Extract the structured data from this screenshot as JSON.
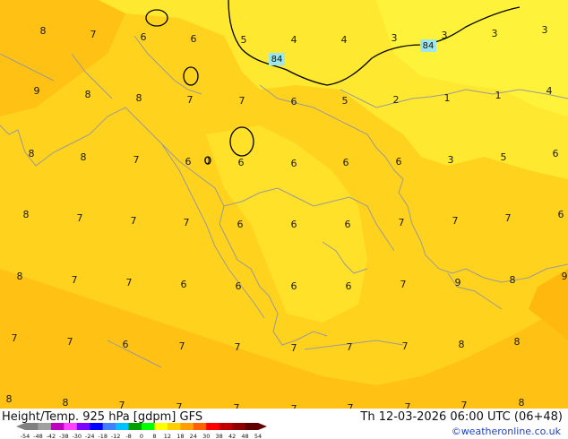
{
  "footer": {
    "title": "Height/Temp. 925 hPa [gdpm] GFS",
    "datetime": "Th 12-03-2026 06:00 UTC (06+48)",
    "credit": "©weatheronline.co.uk"
  },
  "colorbar": {
    "tick_labels": [
      "-54",
      "-48",
      "-42",
      "-38",
      "-30",
      "-24",
      "-18",
      "-12",
      "-8",
      "0",
      "8",
      "12",
      "18",
      "24",
      "30",
      "38",
      "42",
      "48",
      "54"
    ],
    "colors": [
      "#808080",
      "#a0a0a0",
      "#c000c0",
      "#ff40ff",
      "#8000ff",
      "#0000ff",
      "#4080ff",
      "#00c0ff",
      "#00a000",
      "#00ff00",
      "#ffff00",
      "#ffd000",
      "#ffa000",
      "#ff6000",
      "#ff0000",
      "#c00000",
      "#900000",
      "#600000"
    ]
  },
  "map": {
    "field_colors": {
      "dominant": "#ffd21e",
      "warm": "#ffc214",
      "cool": "#ffe830",
      "coast": "#a0a0a0",
      "contour": "#000000"
    },
    "contour_labels": [
      "84",
      "84"
    ],
    "temperature_labels": [
      "8",
      "7",
      "6",
      "6",
      "5",
      "4",
      "4",
      "3",
      "3",
      "3",
      "3",
      "9",
      "8",
      "8",
      "7",
      "7",
      "6",
      "5",
      "2",
      "1",
      "1",
      "4",
      "8",
      "8",
      "7",
      "6",
      "0",
      "6",
      "6",
      "6",
      "6",
      "3",
      "5",
      "6",
      "8",
      "7",
      "7",
      "7",
      "6",
      "6",
      "6",
      "7",
      "7",
      "7",
      "6",
      "8",
      "7",
      "7",
      "6",
      "6",
      "6",
      "6",
      "7",
      "9",
      "8",
      "9",
      "7",
      "7",
      "6",
      "7",
      "7",
      "7",
      "7",
      "7",
      "8",
      "8",
      "8",
      "8",
      "7",
      "7",
      "7",
      "7",
      "7",
      "7",
      "7",
      "8"
    ]
  }
}
